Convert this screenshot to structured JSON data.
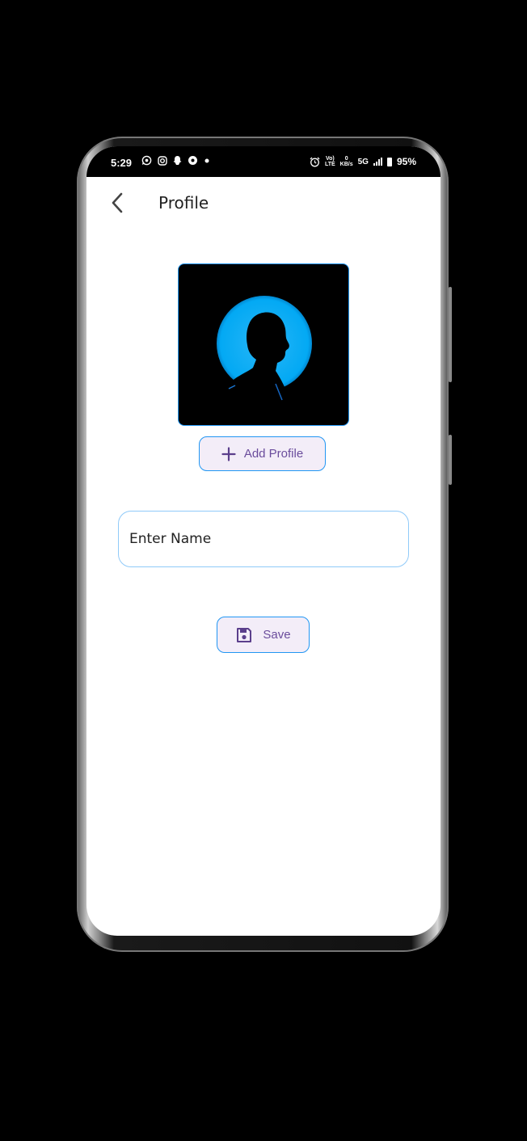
{
  "status_bar": {
    "time": "5:29",
    "network_speed_value": "0",
    "network_speed_unit": "KB/s",
    "volte_top": "Vo)",
    "volte_bottom": "LTE",
    "network_type": "5G",
    "battery": "95%",
    "left_icons": [
      "whatsapp-icon",
      "instagram-icon",
      "snapchat-icon",
      "settings-icon",
      "dot-icon"
    ],
    "right_icons": [
      "alarm-icon",
      "signal-icon",
      "battery-icon"
    ]
  },
  "app_bar": {
    "title": "Profile",
    "back_icon": "chevron-left-icon"
  },
  "profile": {
    "avatar_icon": "person-silhouette-icon",
    "add_button_icon": "plus-icon",
    "add_button_label": "Add Profile"
  },
  "form": {
    "name_label": "Enter Name"
  },
  "actions": {
    "save_icon": "floppy-disk-icon",
    "save_label": "Save"
  },
  "colors": {
    "accent_border": "#2196f3",
    "button_bg": "#f3edf8",
    "button_text": "#6a4c9c",
    "avatar_glow": "#03a9f4"
  }
}
